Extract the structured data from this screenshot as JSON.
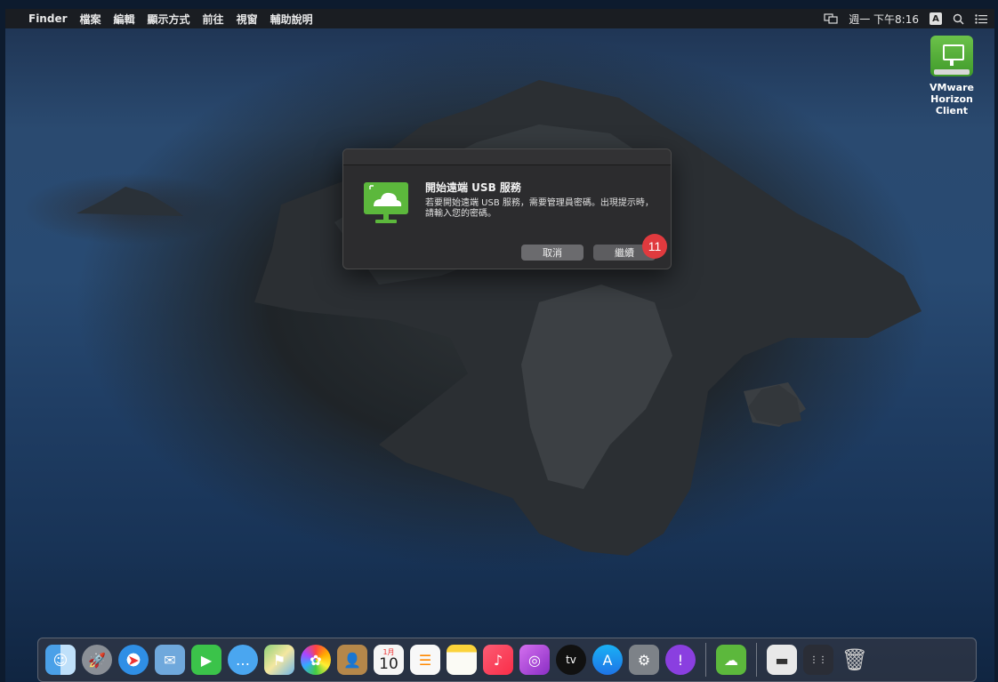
{
  "menubar": {
    "apple_glyph": "",
    "items": [
      "Finder",
      "檔案",
      "編輯",
      "顯示方式",
      "前往",
      "視窗",
      "輔助說明"
    ],
    "clock": "週一 下午8:16",
    "input_source": "A"
  },
  "desktop": {
    "icon_label_line1": "VMware Horizon",
    "icon_label_line2": "Client"
  },
  "dialog": {
    "title": "開始遠端 USB 服務",
    "message": "若要開始遠端 USB 服務，需要管理員密碼。出現提示時，請輸入您的密碼。",
    "cancel_label": "取消",
    "continue_label": "繼續"
  },
  "annotation": {
    "step_number": "11",
    "color": "#e03a3e"
  },
  "dock": {
    "calendar_day": "10",
    "calendar_month": "1月",
    "apps": [
      "finder-icon",
      "launchpad-icon",
      "safari-icon",
      "mail-icon",
      "facetime-icon",
      "messages-icon",
      "maps-icon",
      "photos-icon",
      "contacts-icon",
      "calendar-icon",
      "reminders-icon",
      "notes-icon",
      "music-icon",
      "podcasts-icon",
      "tv-icon",
      "app-store-icon",
      "system-preferences-icon",
      "feedback-assistant-icon",
      "vmware-horizon-icon",
      "document-icon",
      "screenshot-icon",
      "trash-icon"
    ]
  },
  "colors": {
    "horizon_green": "#5cb83c",
    "menubar_bg": "#1a1d22",
    "dialog_bg": "#2c2c2e"
  }
}
